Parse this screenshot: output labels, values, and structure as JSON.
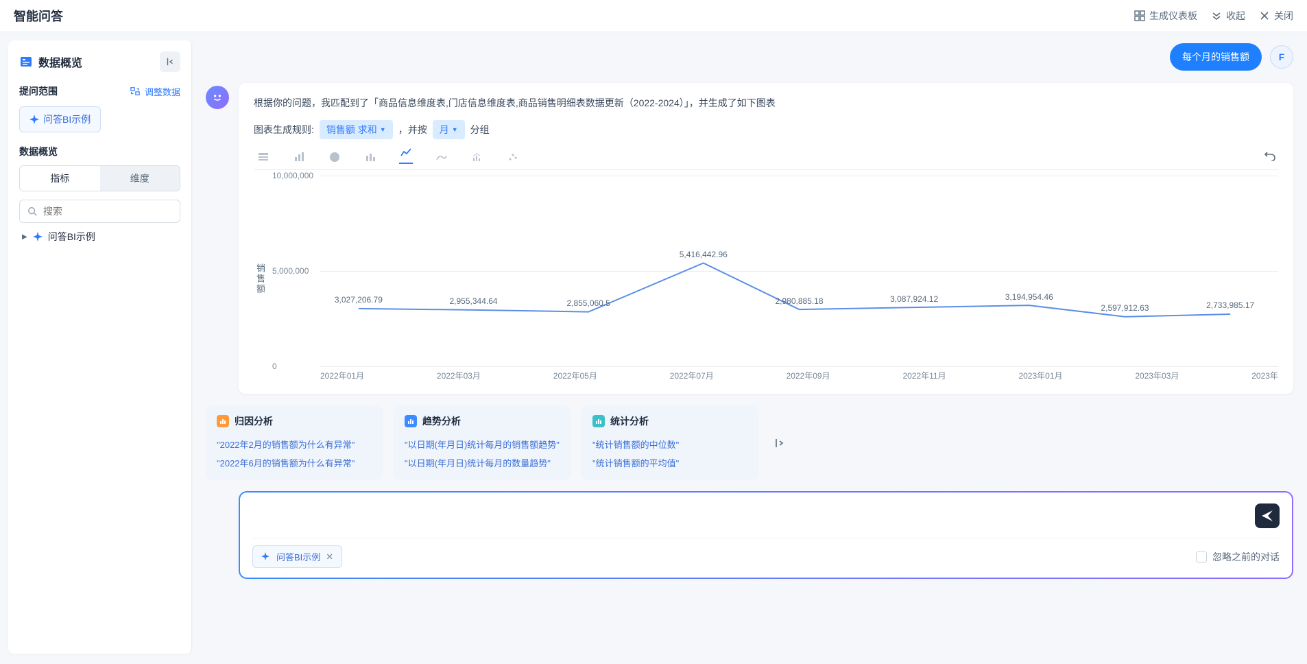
{
  "header": {
    "title": "智能问答",
    "actions": {
      "dashboard": "生成仪表板",
      "collapse": "收起",
      "close": "关闭"
    }
  },
  "sidebar": {
    "title": "数据概览",
    "scope_label": "提问范围",
    "adjust_label": "调整数据",
    "topic_chip": "问答BI示例",
    "overview_label": "数据概览",
    "tabs": {
      "metric": "指标",
      "dimension": "维度"
    },
    "search_placeholder": "搜索",
    "tree_item": "问答BI示例"
  },
  "query": {
    "text": "每个月的销售额",
    "avatar_letter": "F"
  },
  "answer": {
    "response_text": "根据你的问题，我匹配到了「商品信息维度表,门店信息维度表,商品销售明细表数据更新（2022-2024）」，并生成了如下图表",
    "rule_prefix": "图表生成规则:",
    "metric_chip": "销售额 求和",
    "rule_mid": "，并按",
    "group_chip": "月",
    "rule_suffix": "分组"
  },
  "chart_data": {
    "type": "line",
    "ylabel": "销售额",
    "y_ticks": [
      "0",
      "5,000,000",
      "10,000,000"
    ],
    "ylim": [
      0,
      10000000
    ],
    "categories": [
      "2022年01月",
      "2022年03月",
      "2022年05月",
      "2022年07月",
      "2022年09月",
      "2022年11月",
      "2023年01月",
      "2023年03月",
      "2023年"
    ],
    "points": [
      {
        "x_pct": 4,
        "value": 3027206.79,
        "label": "3,027,206.79"
      },
      {
        "x_pct": 16,
        "value": 2955344.64,
        "label": "2,955,344.64"
      },
      {
        "x_pct": 28,
        "value": 2855060.5,
        "label": "2,855,060.5"
      },
      {
        "x_pct": 40,
        "value": 5416442.96,
        "label": "5,416,442.96"
      },
      {
        "x_pct": 50,
        "value": 2980885.18,
        "label": "2,980,885.18"
      },
      {
        "x_pct": 62,
        "value": 3087924.12,
        "label": "3,087,924.12"
      },
      {
        "x_pct": 74,
        "value": 3194954.46,
        "label": "3,194,954.46"
      },
      {
        "x_pct": 84,
        "value": 2597912.63,
        "label": "2,597,912.63"
      },
      {
        "x_pct": 95,
        "value": 2733985.17,
        "label": "2,733,985.17"
      }
    ]
  },
  "suggestions": {
    "cards": [
      {
        "badge": "orange",
        "title": "归因分析",
        "items": [
          "\"2022年2月的销售额为什么有异常\"",
          "\"2022年6月的销售额为什么有异常\""
        ]
      },
      {
        "badge": "blue",
        "title": "趋势分析",
        "items": [
          "\"以日期(年月日)统计每月的销售额趋势\"",
          "\"以日期(年月日)统计每月的数量趋势\""
        ]
      },
      {
        "badge": "teal",
        "title": "统计分析",
        "items": [
          "\"统计销售额的中位数\"",
          "\"统计销售额的平均值\""
        ]
      }
    ]
  },
  "input": {
    "chip_label": "问答BI示例",
    "ignore_label": "忽略之前的对话"
  }
}
